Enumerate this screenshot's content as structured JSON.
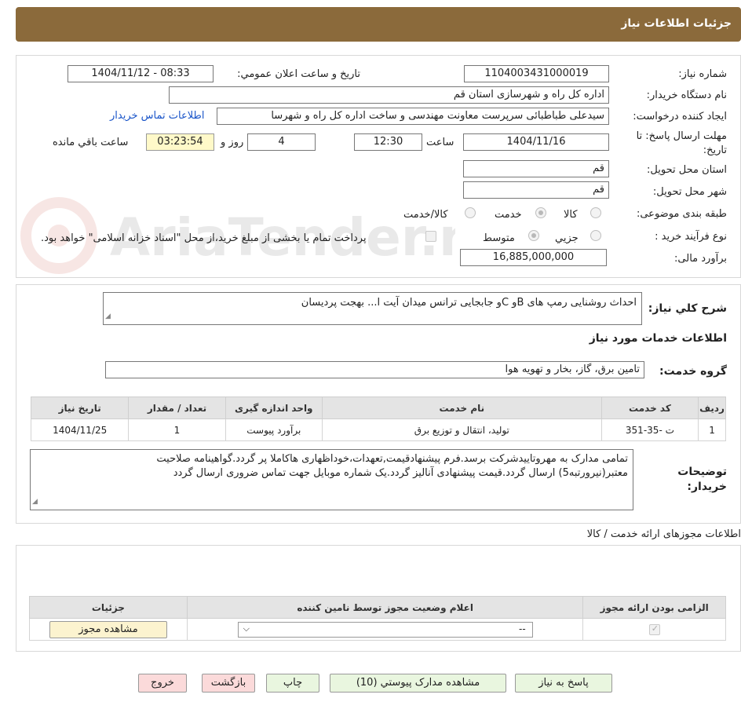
{
  "header": {
    "title": "جزئیات اطلاعات نیاز"
  },
  "watermark": {
    "text": "AriaTender.net"
  },
  "form": {
    "need_number_label": "شماره نیاز:",
    "need_number": "1104003431000019",
    "announce_label": "تاریخ و ساعت اعلان عمومي:",
    "announce_value": "1404/11/12 - 08:33",
    "buyer_org_label": "نام دستگاه خريدار:",
    "buyer_org": "اداره کل راه و شهرسازی استان قم",
    "requester_label": "ايجاد کننده درخواست:",
    "requester": "سیدعلی طباطبائی سرپرست معاونت مهندسی و ساخت اداره کل راه و شهرسا",
    "contact_link": "اطلاعات تماس خريدار",
    "deadline_label_1": "مهلت ارسال پاسخ: تا",
    "deadline_label_2": "تاریخ:",
    "deadline_date": "1404/11/16",
    "time_label": "ساعت",
    "deadline_time": "12:30",
    "days_value": "4",
    "days_label": "روز و",
    "remaining_time": "03:23:54",
    "remaining_label": "ساعت باقي مانده",
    "province_label": "استان محل تحویل:",
    "province": "قم",
    "city_label": "شهر محل تحویل:",
    "city": "قم",
    "category_label": "طبقه بندی موضوعی:",
    "category_options": [
      "کالا",
      "خدمت",
      "کالا/خدمت"
    ],
    "category_selected": "خدمت",
    "process_label": "نوع فرآیند خرید :",
    "process_options": [
      "جزيي",
      "متوسط"
    ],
    "process_selected": "متوسط",
    "payment_note": "پرداخت تمام يا بخشی از مبلغ خريد،از محل \"اسناد خزانه اسلامی\" خواهد بود.",
    "budget_label": "برآورد مالی:",
    "budget": "16,885,000,000"
  },
  "summary": {
    "label": "شرح کلي نياز:",
    "value": "احداث روشنایی رمپ های Bو Cو جابجایی ترانس میدان آیت ا... بهجت پردیسان"
  },
  "services": {
    "section_title": "اطلاعات خدمات مورد نياز",
    "group_label": "گروه خدمت:",
    "group_value": "تامين برق، گاز، بخار و تهويه هوا",
    "columns": [
      "رديف",
      "کد خدمت",
      "نام خدمت",
      "واحد اندازه گيری",
      "تعداد / مقدار",
      "تاريخ نياز"
    ],
    "rows": [
      [
        "1",
        "ت -35-351",
        "توليد، انتقال و توزيع برق",
        "برآورد پیوست",
        "1",
        "1404/11/25"
      ]
    ]
  },
  "buyer_notes": {
    "label_1": "توضيحات",
    "label_2": "خريدار:",
    "line_1": "تمامی مدارک به مهروتاییدشرکت برسد.فرم پیشنهادقیمت,تعهدات،خوداظهاری هاکاملا پر گردد.گواهینامه صلاحیت",
    "line_2": "معتبر(نیرورتبه5) ارسال گردد.قیمت پیشنهادی آنالیز گردد.یک شماره موبایل جهت تماس ضروری ارسال گردد"
  },
  "permits": {
    "section_title": "اطلاعات مجوزهای ارائه خدمت / کالا",
    "columns": [
      "الزامی بودن ارائه مجوز",
      "اعلام وضعیت مجوز توسط نامین کننده",
      "جزئیات"
    ],
    "select_value": "--",
    "view_button": "مشاهده مجوز"
  },
  "buttons": {
    "reply": "پاسخ به نياز",
    "attachments": "مشاهده مدارک پيوستي (10)",
    "print": "چاپ",
    "back": "بازگشت",
    "exit": "خروج"
  }
}
